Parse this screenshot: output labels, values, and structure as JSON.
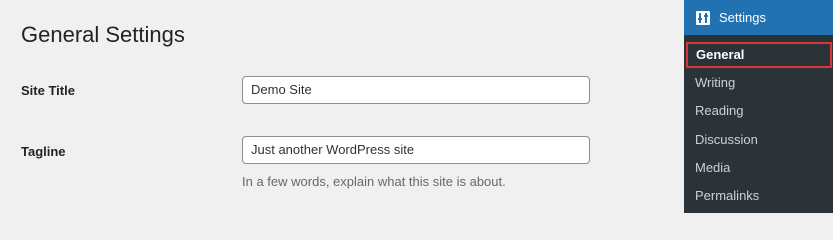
{
  "page": {
    "title": "General Settings"
  },
  "form": {
    "site_title": {
      "label": "Site Title",
      "value": "Demo Site"
    },
    "tagline": {
      "label": "Tagline",
      "value": "Just another WordPress site",
      "description": "In a few words, explain what this site is about."
    }
  },
  "sidebar": {
    "menu": {
      "label": "Settings",
      "icon": "settings-sliders-icon"
    },
    "items": [
      {
        "label": "General",
        "current": true
      },
      {
        "label": "Writing",
        "current": false
      },
      {
        "label": "Reading",
        "current": false
      },
      {
        "label": "Discussion",
        "current": false
      },
      {
        "label": "Media",
        "current": false
      },
      {
        "label": "Permalinks",
        "current": false
      }
    ]
  },
  "colors": {
    "sidebar_bg": "#2c3338",
    "menu_active_bg": "#2271b1",
    "highlight_border": "#d63638"
  }
}
